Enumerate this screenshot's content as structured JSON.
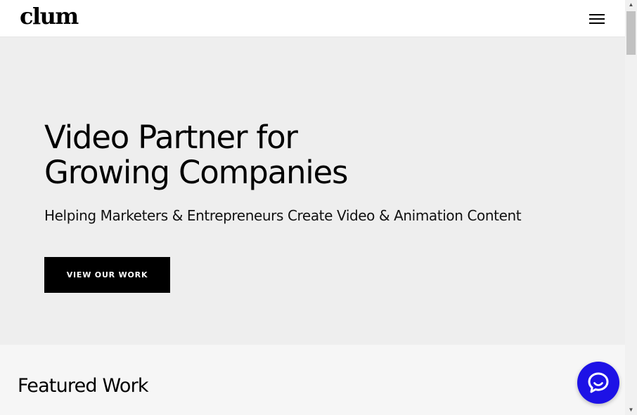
{
  "header": {
    "logo_text": "clum",
    "menu_icon": "hamburger-menu-icon"
  },
  "hero": {
    "title_line1": "Video Partner for",
    "title_line2": "Growing Companies",
    "subtitle": "Helping Marketers & Entrepreneurs Create Video & Animation Content",
    "cta_label": "VIEW OUR WORK"
  },
  "featured": {
    "title": "Featured Work"
  },
  "chat": {
    "icon": "chat-bubble-icon",
    "color": "#1d12e6"
  },
  "colors": {
    "hero_background": "#eeeeee",
    "featured_background": "#f6f6f6",
    "button_background": "#000000"
  },
  "scrollbar": {
    "up_arrow": "▲",
    "down_arrow": "▼"
  }
}
